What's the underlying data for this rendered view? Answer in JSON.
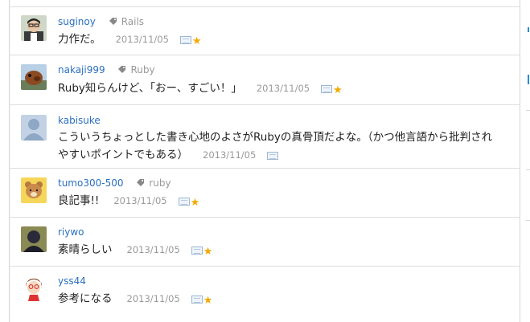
{
  "comments": [
    {
      "user": "suginoy",
      "tag": "Rails",
      "text": "力作だ。",
      "date": "2013/11/05",
      "starred": true
    },
    {
      "user": "nakaji999",
      "tag": "Ruby",
      "text": "Ruby知らんけど、「おー、すごい！」",
      "date": "2013/11/05",
      "starred": true
    },
    {
      "user": "kabisuke",
      "tag": "",
      "text_line1": "こういうちょっとした書き心地のよさがRubyの真骨頂だよな。（かつ他言語から批判され",
      "text_line2": "やすいポイントでもある）",
      "date": "2013/11/05",
      "starred": false
    },
    {
      "user": "tumo300-500",
      "tag": "ruby",
      "text": "良記事!!",
      "date": "2013/11/05",
      "starred": true
    },
    {
      "user": "riywo",
      "tag": "",
      "text": "素晴らしい",
      "date": "2013/11/05",
      "starred": true
    },
    {
      "user": "yss44",
      "tag": "",
      "text": "参考になる",
      "date": "2013/11/05",
      "starred": true
    }
  ],
  "icons": {
    "tag": "tag-icon",
    "screenshot": "screenshot-icon",
    "star": "star-icon"
  },
  "colors": {
    "username": "#2a6fc0",
    "meta": "#999999",
    "star": "#f2a900"
  },
  "glyphs": {
    "star": "★"
  }
}
